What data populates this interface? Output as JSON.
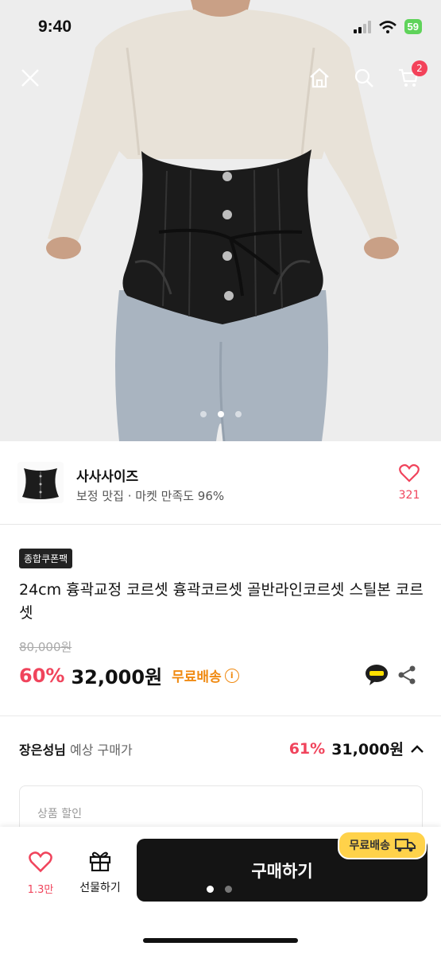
{
  "status": {
    "time": "9:40",
    "battery": "59"
  },
  "nav": {
    "cart_count": "2"
  },
  "colors": {
    "accent": "#f0445c",
    "free_ship": "#f08a12",
    "buy_bg": "#141414"
  },
  "seller": {
    "name": "사사사이즈",
    "subtitle": "보정 맛집 · 마켓 만족도 96%",
    "like_count": "321"
  },
  "product": {
    "coupon_tag": "종합쿠폰팩",
    "title": "24cm 흉곽교정 코르셋 흉곽코르셋 골반라인코르셋 스틸본 코르셋",
    "original_price": "80,000원",
    "discount": "60%",
    "price": "32,000원",
    "free_shipping": "무료배송"
  },
  "expected": {
    "user": "장은성님",
    "label": "예상 구매가",
    "discount": "61%",
    "price": "31,000원"
  },
  "discount_box": {
    "label": "상품 할인"
  },
  "bottom": {
    "like_count": "1.3만",
    "gift_label": "선물하기",
    "buy_label": "구매하기",
    "ship_pill": "무료배송"
  }
}
